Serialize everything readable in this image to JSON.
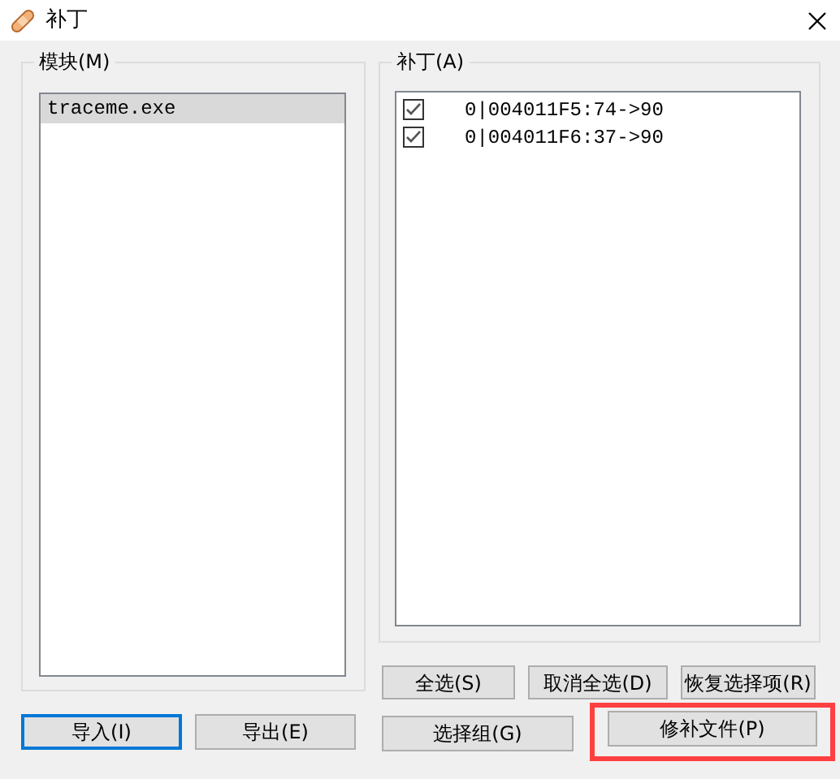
{
  "window": {
    "title": "补丁"
  },
  "modules": {
    "label": "模块(M)",
    "items": [
      {
        "name": "traceme.exe",
        "selected": true
      }
    ]
  },
  "patches": {
    "label": "补丁(A)",
    "items": [
      {
        "text": "0|004011F5:74->90",
        "checked": true
      },
      {
        "text": "0|004011F6:37->90",
        "checked": true
      }
    ]
  },
  "module_buttons": [
    {
      "label": "导入(I)",
      "focused": true
    },
    {
      "label": "导出(E)",
      "focused": false
    }
  ],
  "patch_buttons": [
    {
      "label": "全选(S)"
    },
    {
      "label": "取消全选(D)"
    },
    {
      "label": "恢复选择项(R)"
    }
  ],
  "bottom_buttons": [
    {
      "label": "选择组(G)",
      "highlighted": false
    },
    {
      "label": "修补文件(P)",
      "highlighted": true
    }
  ]
}
